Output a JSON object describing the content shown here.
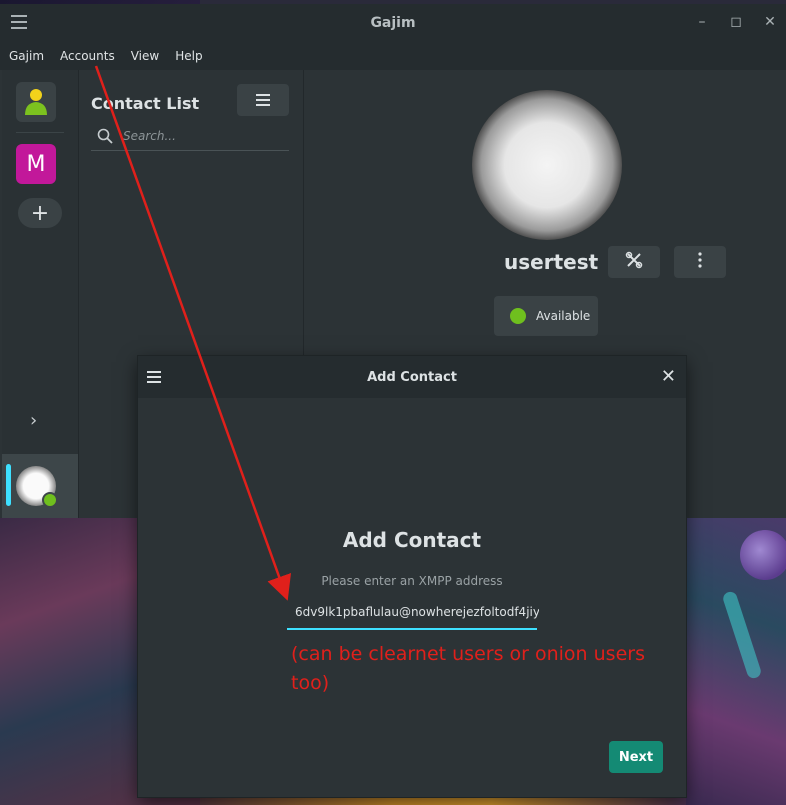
{
  "window": {
    "title": "Gajim",
    "controls": {
      "minimize": "–",
      "maximize": "◻",
      "close": "✕"
    }
  },
  "menubar": [
    "Gajim",
    "Accounts",
    "View",
    "Help"
  ],
  "sidebar": {
    "account_letter": "M",
    "add_symbol": "+",
    "expand_symbol": "›"
  },
  "contacts": {
    "title": "Contact List",
    "search_placeholder": "Search..."
  },
  "profile": {
    "username": "usertest",
    "status": "Available",
    "status_color": "#6fbf1e"
  },
  "dialog": {
    "header_title": "Add Contact",
    "body_title": "Add Contact",
    "prompt": "Please enter an XMPP address",
    "address_value": "6dv9lk1pbaflulau@nowherejezfoltodf4jiy",
    "next_label": "Next",
    "close_symbol": "✕"
  },
  "annotation": {
    "note": "(can be clearnet users or onion users too)",
    "color": "#e0201b"
  }
}
